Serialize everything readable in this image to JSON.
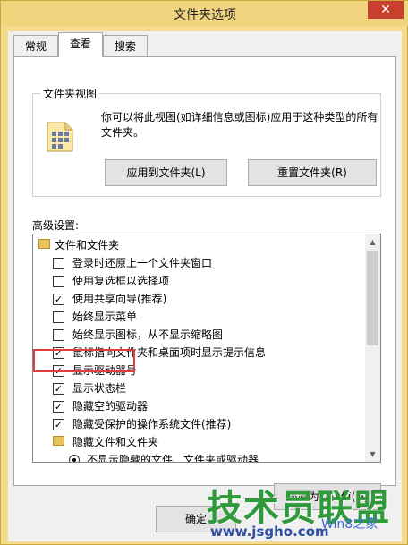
{
  "window": {
    "title": "文件夹选项",
    "close_glyph": "✕"
  },
  "tabs": [
    {
      "label": "常规",
      "active": false
    },
    {
      "label": "查看",
      "active": true
    },
    {
      "label": "搜索",
      "active": false
    }
  ],
  "folder_views": {
    "title": "文件夹视图",
    "description": "你可以将此视图(如详细信息或图标)应用于这种类型的所有文件夹。",
    "apply_button": "应用到文件夹(L)",
    "reset_button": "重置文件夹(R)"
  },
  "advanced": {
    "label": "高级设置:",
    "items": [
      {
        "type": "folder",
        "text": "文件和文件夹"
      },
      {
        "type": "checkbox",
        "checked": false,
        "text": "登录时还原上一个文件夹窗口"
      },
      {
        "type": "checkbox",
        "checked": false,
        "text": "使用复选框以选择项"
      },
      {
        "type": "checkbox",
        "checked": true,
        "text": "使用共享向导(推荐)"
      },
      {
        "type": "checkbox",
        "checked": false,
        "text": "始终显示菜单"
      },
      {
        "type": "checkbox",
        "checked": false,
        "text": "始终显示图标，从不显示缩略图"
      },
      {
        "type": "checkbox",
        "checked": true,
        "text": "鼠标指向文件夹和桌面项时显示提示信息"
      },
      {
        "type": "checkbox",
        "checked": true,
        "text": "显示驱动器号"
      },
      {
        "type": "checkbox",
        "checked": true,
        "text": "显示状态栏"
      },
      {
        "type": "checkbox",
        "checked": true,
        "text": "隐藏空的驱动器"
      },
      {
        "type": "checkbox",
        "checked": true,
        "text": "隐藏受保护的操作系统文件(推荐)"
      },
      {
        "type": "folder",
        "text": "隐藏文件和文件夹"
      },
      {
        "type": "radio",
        "checked": true,
        "text": "不显示隐藏的文件、文件夹或驱动器"
      }
    ]
  },
  "buttons": {
    "restore_defaults": "还原为默认值(D)",
    "ok": "确定"
  },
  "watermark": {
    "brand": "技术员联盟",
    "url": "www.jsgho.com",
    "sub": "Win8之家"
  }
}
